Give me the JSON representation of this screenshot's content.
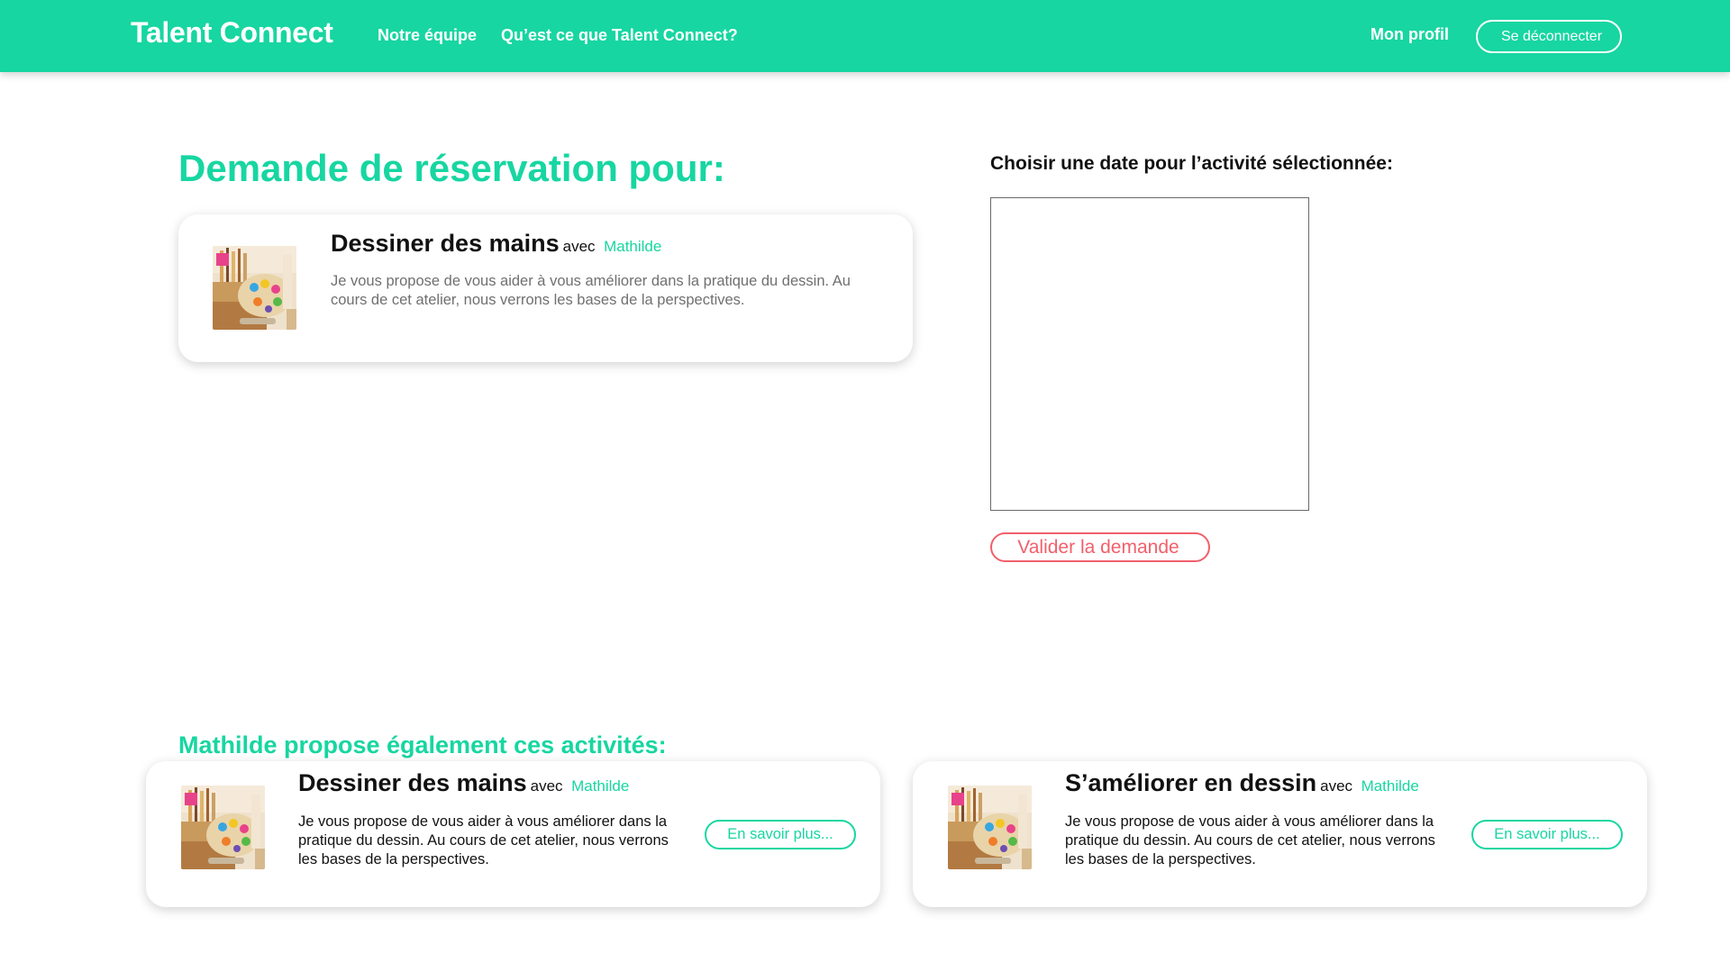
{
  "navbar": {
    "brand": "Talent Connect",
    "links": [
      "Notre équipe",
      "Qu’est ce que Talent Connect?"
    ],
    "profile": "Mon profil",
    "logout": "Se déconnecter"
  },
  "booking": {
    "title": "Demande de réservation pour:",
    "date_label": "Choisir une date pour l’activité sélectionnée:",
    "validate": "Valider la demande",
    "activity": {
      "title": "Dessiner des mains",
      "avec": "avec",
      "host": "Mathilde",
      "description": "Je vous propose de vous aider à vous améliorer dans la pratique du dessin. Au cours de cet atelier, nous verrons les bases de la perspectives."
    }
  },
  "others": {
    "title": "Mathilde propose également ces activités:",
    "items": [
      {
        "title": "Dessiner des mains",
        "avec": "avec",
        "host": "Mathilde",
        "description": "Je vous propose de vous aider à vous améliorer dans la pratique du dessin. Au cours de cet atelier, nous verrons les bases de la perspectives.",
        "button": "En savoir plus..."
      },
      {
        "title": "S’améliorer en dessin",
        "avec": "avec",
        "host": "Mathilde",
        "description": "Je vous propose de vous aider à vous améliorer dans la pratique du dessin. Au cours de cet atelier, nous verrons les bases de la perspectives.",
        "button": "En savoir plus..."
      }
    ]
  },
  "colors": {
    "brand": "#17d6a1",
    "danger": "#f25f6b"
  }
}
